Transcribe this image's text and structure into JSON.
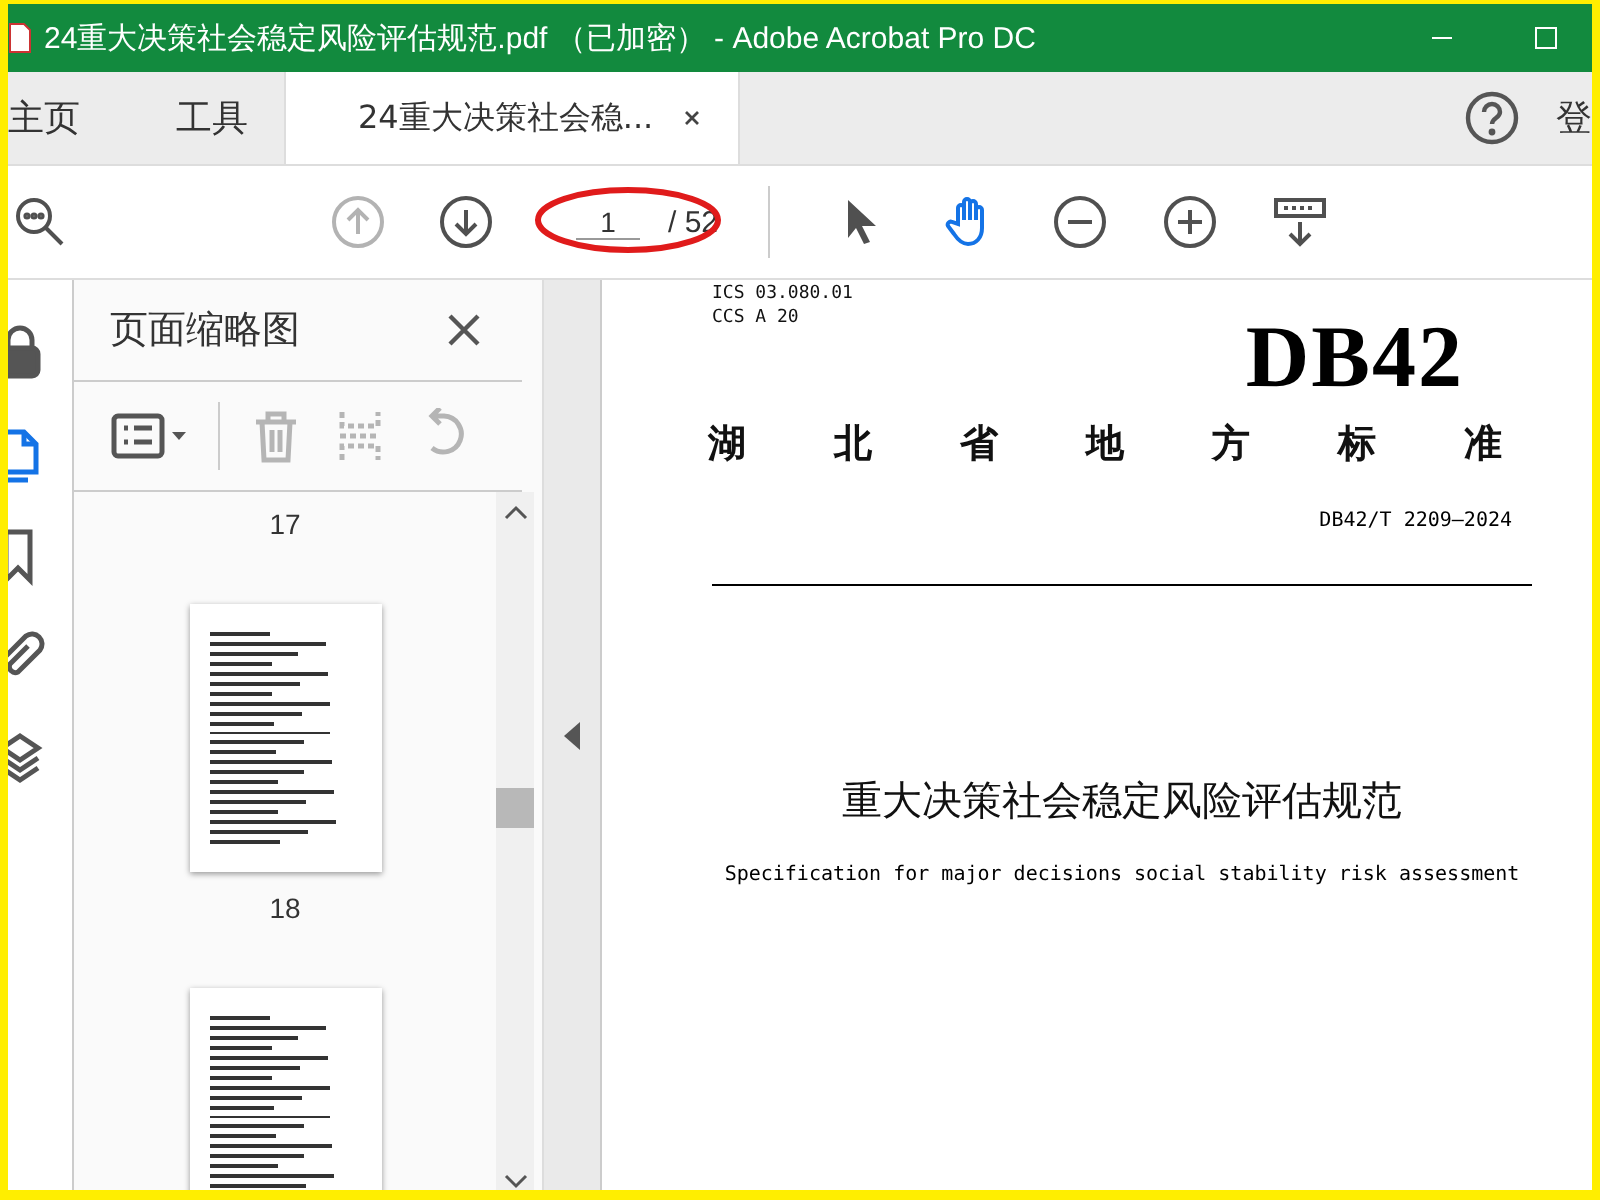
{
  "window": {
    "title": "24重大决策社会稳定风险评估规范.pdf （已加密） - Adobe Acrobat Pro DC"
  },
  "tabs": [
    {
      "label": "主页",
      "selected": false
    },
    {
      "label": "工具",
      "selected": false
    },
    {
      "label": "24重大决策社会稳...",
      "selected": true
    }
  ],
  "account": {
    "label": "登"
  },
  "toolbar": {
    "tools": [
      {
        "kind": "search",
        "disabled": false,
        "selected": false
      },
      {
        "kind": "prev",
        "disabled": true,
        "selected": false
      },
      {
        "kind": "next",
        "disabled": false,
        "selected": false
      },
      {
        "kind": "pointer",
        "disabled": false,
        "selected": false
      },
      {
        "kind": "hand",
        "disabled": false,
        "selected": true
      },
      {
        "kind": "zoom-out",
        "disabled": false,
        "selected": false
      },
      {
        "kind": "zoom-in",
        "disabled": false,
        "selected": false
      },
      {
        "kind": "keyboard",
        "disabled": false,
        "selected": false
      }
    ],
    "page_input": {
      "value": "1"
    },
    "page_total": "/ 52"
  },
  "rail": [
    {
      "kind": "lock",
      "selected": false
    },
    {
      "kind": "pages",
      "selected": true
    },
    {
      "kind": "bookmark",
      "selected": false
    },
    {
      "kind": "clip",
      "selected": false
    },
    {
      "kind": "layers",
      "selected": false
    }
  ],
  "panel": {
    "title": "页面缩略图",
    "tools": [
      {
        "kind": "options",
        "disabled": false
      },
      {
        "kind": "trash",
        "disabled": true
      },
      {
        "kind": "extract",
        "disabled": true
      },
      {
        "kind": "rotate",
        "disabled": true
      }
    ],
    "items": [
      {
        "kind": "label",
        "text": "17"
      },
      {
        "kind": "page"
      },
      {
        "kind": "label",
        "text": "18"
      },
      {
        "kind": "page"
      }
    ]
  },
  "document": {
    "lines": [
      {
        "kind": "code",
        "text": "ICS 03.080.01"
      },
      {
        "kind": "code",
        "text": "CCS A 20"
      },
      {
        "kind": "mark",
        "text": "DB42"
      },
      {
        "kind": "spaced",
        "text": "湖北省地方标准"
      },
      {
        "kind": "number",
        "text": "DB42/T 2209—2024"
      },
      {
        "kind": "rule"
      },
      {
        "kind": "title",
        "text": "重大决策社会稳定风险评估规范"
      },
      {
        "kind": "subtitle",
        "text": "Specification for major decisions social stability risk assessment"
      }
    ]
  }
}
